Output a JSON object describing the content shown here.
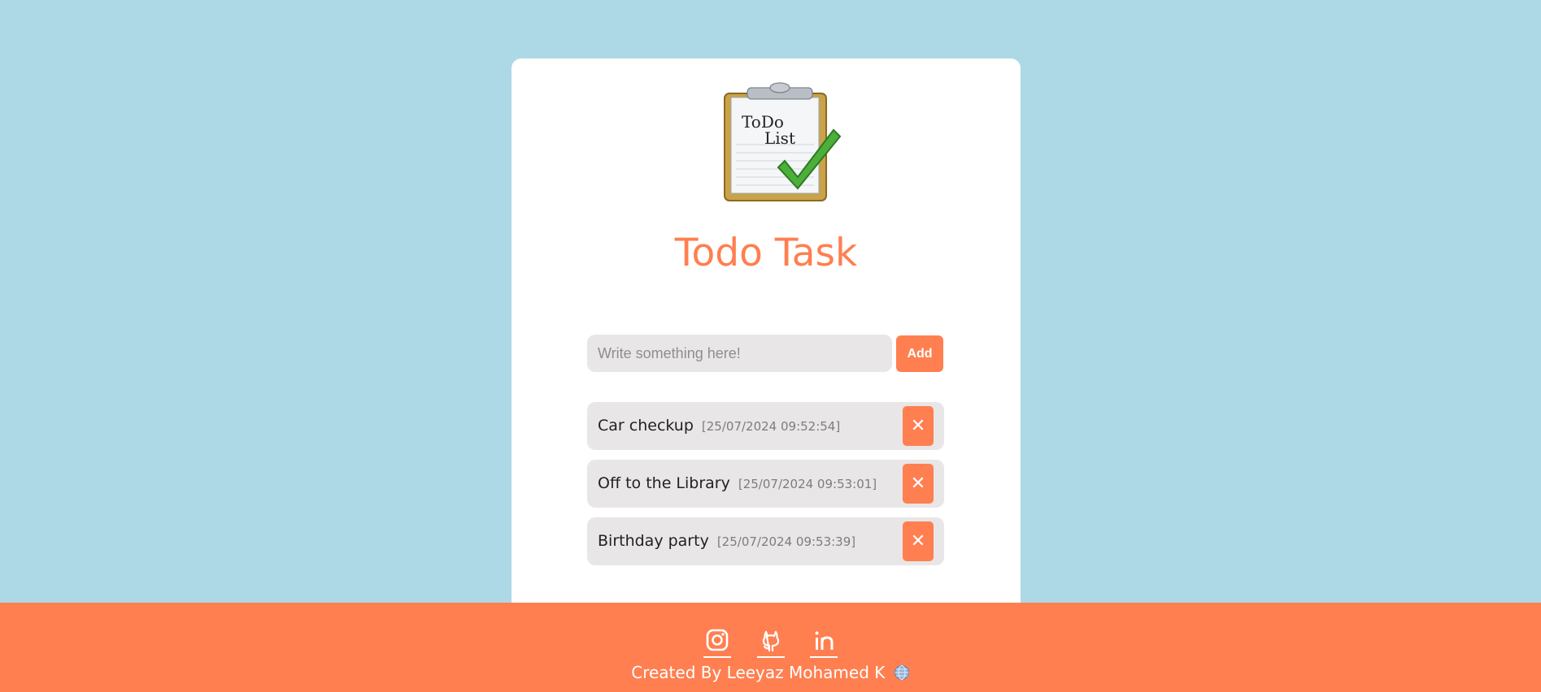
{
  "app": {
    "title": "Todo Task",
    "logo": {
      "label_line1": "ToDo",
      "label_line2": "List"
    }
  },
  "input": {
    "placeholder": "Write something here!",
    "value": "",
    "add_label": "Add"
  },
  "tasks": [
    {
      "text": "Car checkup",
      "time": "[25/07/2024 09:52:54]",
      "delete_label": "✕"
    },
    {
      "text": "Off to the Library",
      "time": "[25/07/2024 09:53:01]",
      "delete_label": "✕"
    },
    {
      "text": "Birthday party",
      "time": "[25/07/2024 09:53:39]",
      "delete_label": "✕"
    }
  ],
  "footer": {
    "icons": [
      "instagram-icon",
      "github-icon",
      "linkedin-icon"
    ],
    "credit": "Created By Leeyaz Mohamed K"
  },
  "colors": {
    "background": "#add8e6",
    "accent": "#ff7f50",
    "card": "#ffffff",
    "field": "#e8e6e6"
  }
}
